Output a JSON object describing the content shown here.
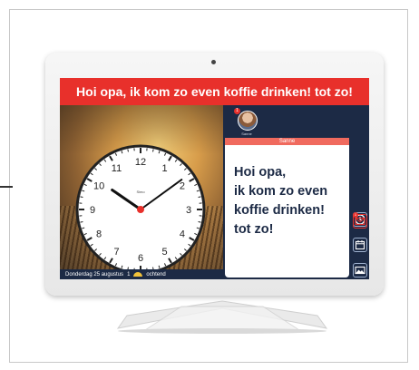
{
  "banner": {
    "text": "Hoi opa, ik kom zo even koffie drinken! tot zo!"
  },
  "clock": {
    "numerals": [
      "12",
      "1",
      "2",
      "3",
      "4",
      "5",
      "6",
      "7",
      "8",
      "9",
      "10",
      "11"
    ],
    "brand": "Simo",
    "hour": 10,
    "minute": 9
  },
  "status": {
    "date": "Donderdag 25 augustus",
    "count": "1",
    "part_of_day": "ochtend"
  },
  "contact": {
    "name": "Sanne",
    "badge": "1",
    "header": "Sanne"
  },
  "message": {
    "lines": [
      "Hoi opa,",
      "ik kom zo even",
      "koffie drinken!",
      "tot zo!"
    ]
  },
  "menu": {
    "items": [
      "clock-icon",
      "calendar-icon",
      "photos-icon",
      "mail-icon"
    ],
    "mail_badge": "1"
  },
  "colors": {
    "accent_red": "#e8302b",
    "navy": "#1c2a45",
    "sender_bar": "#f06a5e"
  }
}
